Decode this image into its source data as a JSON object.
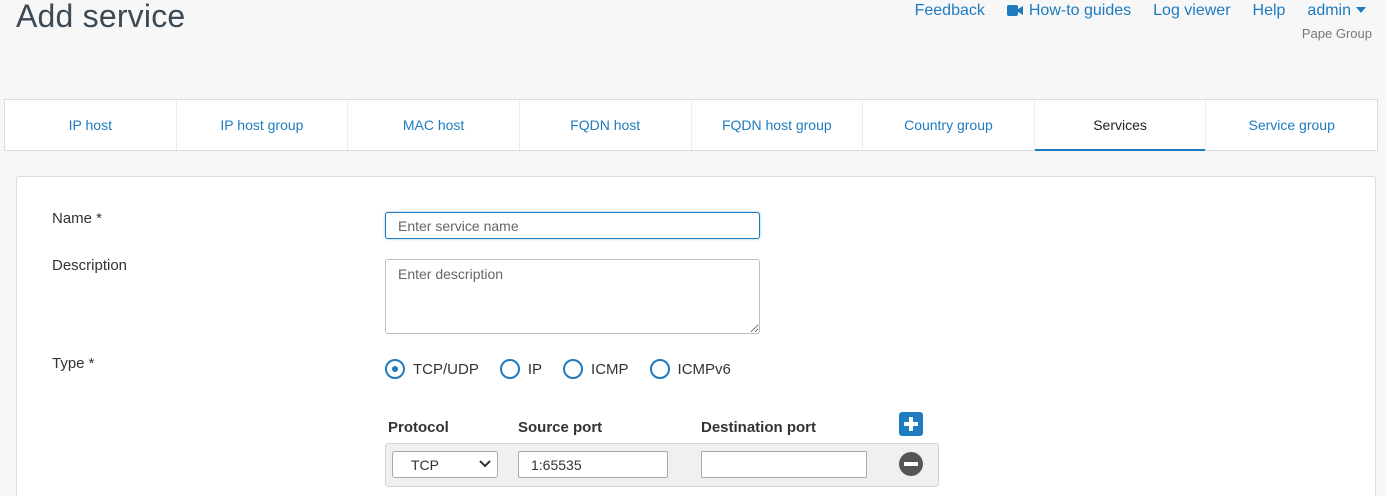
{
  "page": {
    "title": "Add service"
  },
  "topnav": {
    "feedback": "Feedback",
    "howto": "How-to guides",
    "log_viewer": "Log viewer",
    "help": "Help",
    "user": "admin",
    "org": "Pape Group",
    "howto_icon": "video-camera-icon"
  },
  "tabs": [
    {
      "label": "IP host"
    },
    {
      "label": "IP host group"
    },
    {
      "label": "MAC host"
    },
    {
      "label": "FQDN host"
    },
    {
      "label": "FQDN host group"
    },
    {
      "label": "Country group"
    },
    {
      "label": "Services",
      "active": true
    },
    {
      "label": "Service group"
    }
  ],
  "form": {
    "name_label": "Name *",
    "name_placeholder": "Enter service name",
    "name_value": "",
    "description_label": "Description",
    "description_placeholder": "Enter description",
    "description_value": "",
    "type_label": "Type *",
    "type_options": [
      {
        "label": "TCP/UDP",
        "checked": true
      },
      {
        "label": "IP",
        "checked": false
      },
      {
        "label": "ICMP",
        "checked": false
      },
      {
        "label": "ICMPv6",
        "checked": false
      }
    ],
    "ports": {
      "headers": {
        "protocol": "Protocol",
        "source": "Source port",
        "destination": "Destination port"
      },
      "rows": [
        {
          "protocol": "TCP",
          "source": "1:65535",
          "destination": ""
        }
      ]
    }
  },
  "colors": {
    "accent": "#1f7bbf",
    "text": "#333333"
  }
}
